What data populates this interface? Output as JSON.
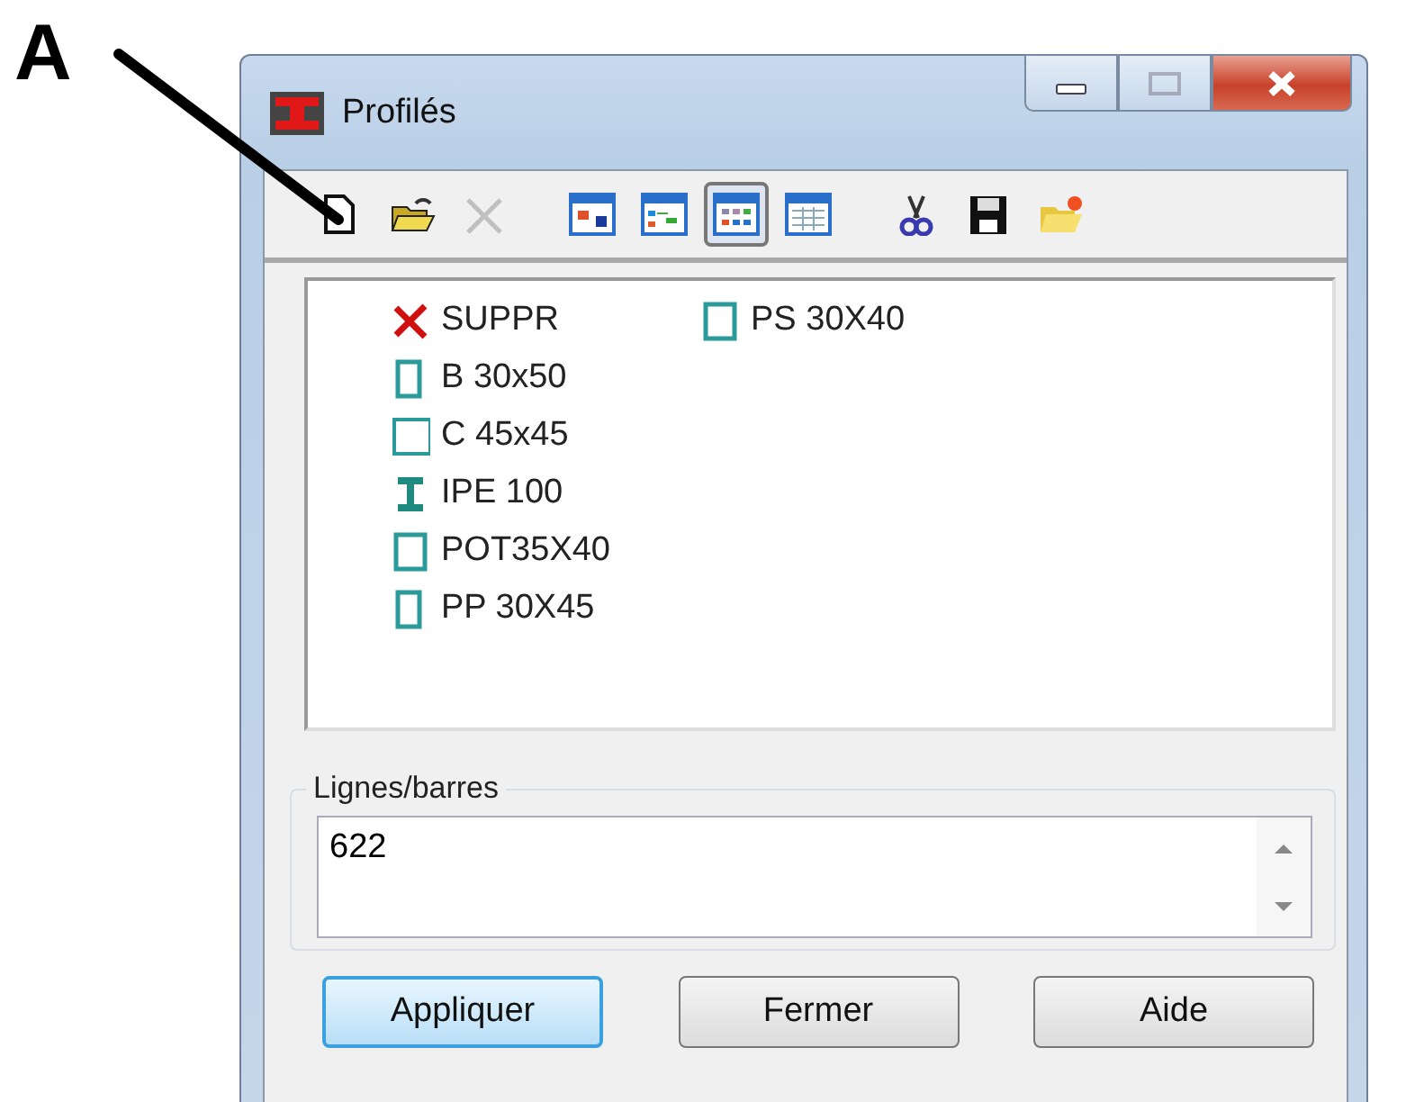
{
  "annotation": {
    "label": "A"
  },
  "window": {
    "title": "Profilés",
    "controls": [
      {
        "kind": "minimize",
        "disabled": false
      },
      {
        "kind": "maximize",
        "disabled": true
      },
      {
        "kind": "close",
        "disabled": false
      }
    ]
  },
  "toolbar": [
    {
      "kind": "new",
      "selected": false,
      "disabled": false
    },
    {
      "kind": "open",
      "selected": false,
      "disabled": false
    },
    {
      "kind": "delete",
      "selected": false,
      "disabled": true
    },
    {
      "kind": "view-large",
      "selected": false,
      "disabled": false
    },
    {
      "kind": "view-small",
      "selected": false,
      "disabled": false
    },
    {
      "kind": "view-list",
      "selected": true,
      "disabled": false
    },
    {
      "kind": "view-details",
      "selected": false,
      "disabled": false
    },
    {
      "kind": "cut",
      "selected": false,
      "disabled": false
    },
    {
      "kind": "save",
      "selected": false,
      "disabled": false
    },
    {
      "kind": "folder",
      "selected": false,
      "disabled": false
    }
  ],
  "profiles": [
    {
      "kind": "deleted",
      "label": "SUPPR"
    },
    {
      "kind": "rect",
      "label": "B 30x50"
    },
    {
      "kind": "square",
      "label": "C 45x45"
    },
    {
      "kind": "ibeam",
      "label": "IPE 100"
    },
    {
      "kind": "rect-wide",
      "label": "POT35X40"
    },
    {
      "kind": "rect",
      "label": "PP 30X45"
    },
    {
      "kind": "rect-wide",
      "label": "PS 30X40"
    }
  ],
  "lines_group": {
    "label": "Lignes/barres",
    "value": "622"
  },
  "buttons": [
    {
      "label": "Appliquer",
      "default": true
    },
    {
      "label": "Fermer",
      "default": false
    },
    {
      "label": "Aide",
      "default": false
    }
  ]
}
